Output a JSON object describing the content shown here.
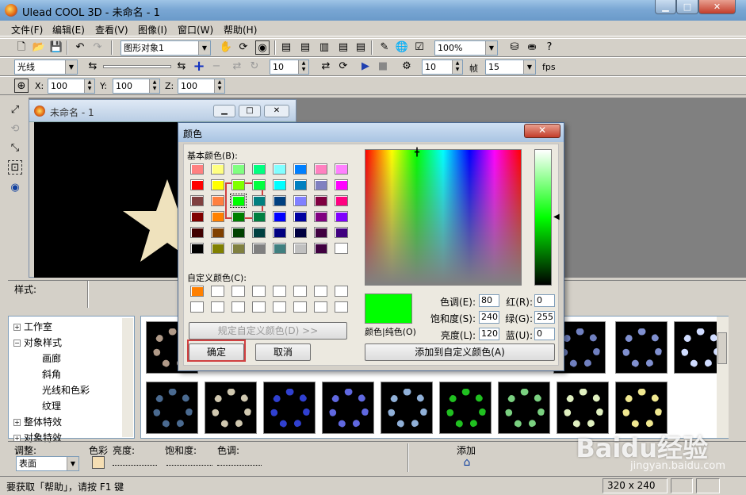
{
  "window": {
    "title": "Ulead COOL 3D - 未命名 - 1",
    "min": "▁",
    "max": "□",
    "close": "✕"
  },
  "menu": [
    "文件(F)",
    "编辑(E)",
    "查看(V)",
    "图像(I)",
    "窗口(W)",
    "帮助(H)"
  ],
  "toolbar1": {
    "object_combo": "图形对象1",
    "zoom_combo": "100%"
  },
  "toolbar2": {
    "light_combo": "光线",
    "value1": "10",
    "value2": "10",
    "frame_label": "帧",
    "frame_value": "15",
    "fps_label": "fps"
  },
  "toolbar3": {
    "x_label": "X:",
    "x_value": "100",
    "y_label": "Y:",
    "y_value": "100",
    "z_label": "Z:",
    "z_value": "100"
  },
  "document": {
    "title": "未命名 - 1"
  },
  "style_panel": {
    "label": "样式:"
  },
  "tree": {
    "items": [
      {
        "label": "工作室",
        "expander": "+"
      },
      {
        "label": "对象样式",
        "expander": "−"
      },
      {
        "label": "画廊"
      },
      {
        "label": "斜角"
      },
      {
        "label": "光线和色彩"
      },
      {
        "label": "纹理"
      },
      {
        "label": "整体特效",
        "expander": "+"
      },
      {
        "label": "对象特效",
        "expander": "+"
      }
    ]
  },
  "thumbs": {
    "row1": [
      "#b09a88",
      "#d0c0a8",
      "#7080c0",
      "#3060d0",
      "#9aa0e0",
      "#4060e0",
      "#c8d8ff"
    ],
    "row2": [
      "#5a7aa0",
      "#d0c8b0",
      "#3040d0",
      "#6068e0",
      "#90b0d8",
      "#20c020",
      "#7ad080",
      "#e0f0c0",
      "#f0e890"
    ]
  },
  "adjust": {
    "label": "调整:",
    "combo": "表面",
    "color_label": "色彩",
    "brightness_label": "亮度:",
    "saturation_label": "饱和度:",
    "hue_label": "色调:",
    "add_label": "添加"
  },
  "status": {
    "hint": "要获取「帮助」，请按 F1 键",
    "size": "320 x 240"
  },
  "watermark": {
    "text": "Baidu经验",
    "sub": "jingyan.baidu.com"
  },
  "dialog": {
    "title": "颜色",
    "close": "✕",
    "basic_label": "基本颜色(B):",
    "custom_label": "自定义颜色(C):",
    "define_button": "规定自定义颜色(D) >>",
    "ok_button": "确定",
    "cancel_button": "取消",
    "solid_label": "颜色|纯色(O)",
    "add_custom_button": "添加到自定义颜色(A)",
    "hue_label": "色调(E):",
    "hue": "80",
    "sat_label": "饱和度(S):",
    "sat": "240",
    "lum_label": "亮度(L):",
    "lum": "120",
    "red_label": "红(R):",
    "red": "0",
    "green_label": "绿(G):",
    "green": "255",
    "blue_label": "蓝(U):",
    "blue": "0",
    "selected_color": "#00ff00",
    "basic_colors": [
      "#ff8080",
      "#ffff80",
      "#80ff80",
      "#00ff80",
      "#80ffff",
      "#0080ff",
      "#ff80c0",
      "#ff80ff",
      "#ff0000",
      "#ffff00",
      "#80ff00",
      "#00ff40",
      "#00ffff",
      "#0080c0",
      "#8080c0",
      "#ff00ff",
      "#804040",
      "#ff8040",
      "#00ff00",
      "#008080",
      "#004080",
      "#8080ff",
      "#800040",
      "#ff0080",
      "#800000",
      "#ff8000",
      "#008000",
      "#008040",
      "#0000ff",
      "#0000a0",
      "#800080",
      "#8000ff",
      "#400000",
      "#804000",
      "#004000",
      "#004040",
      "#000080",
      "#000040",
      "#400040",
      "#400080",
      "#000000",
      "#808000",
      "#808040",
      "#808080",
      "#408080",
      "#c0c0c0",
      "#400040",
      "#ffffff"
    ],
    "custom_colors": [
      "#ff8000",
      "#ffffff",
      "#ffffff",
      "#ffffff",
      "#ffffff",
      "#ffffff",
      "#ffffff",
      "#ffffff",
      "#ffffff",
      "#ffffff",
      "#ffffff",
      "#ffffff",
      "#ffffff",
      "#ffffff",
      "#ffffff",
      "#ffffff"
    ]
  }
}
